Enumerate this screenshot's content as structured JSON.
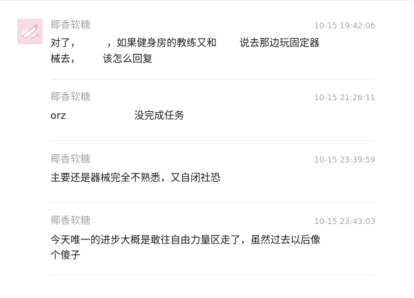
{
  "messages": [
    {
      "sender": "椰香软糖",
      "time": "10-15 19:42:06",
      "lines": [
        {
          "a": "对了，",
          "b": "，如果健身房的教练又和",
          "c": "说去那边玩固定器"
        },
        {
          "a": "械去，",
          "b": "该怎么回复"
        }
      ]
    },
    {
      "sender": "椰香软糖",
      "time": "10-15 21:26:11",
      "lines": [
        {
          "a": "orz",
          "b": "没完成任务"
        }
      ]
    },
    {
      "sender": "椰香软糖",
      "time": "10-15 23:39:59",
      "lines": [
        {
          "a": "主要还是器械完全不熟悉，又自闭社恐"
        }
      ]
    },
    {
      "sender": "椰香软糖",
      "time": "10-15 23:43:03",
      "lines": [
        {
          "a": "今天唯一的进步大概是敢往自由力量区走了，虽然过去以后像"
        },
        {
          "a": "个傻子"
        }
      ]
    }
  ]
}
